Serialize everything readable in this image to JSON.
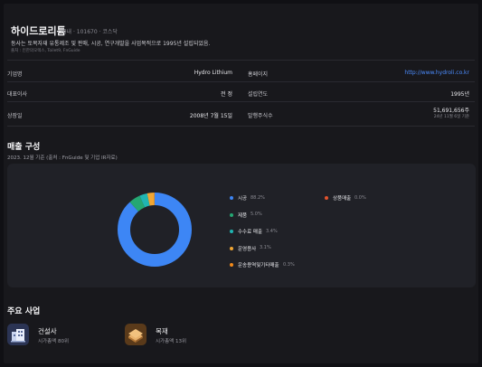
{
  "company": {
    "name": "하이드로리튬",
    "meta": "국내 · 101670 · 코스닥",
    "description": "동사는 토목자재 유통제조 및 판매, 시공, 연구개발을 사업목적으로 1995년 설립되었음.",
    "source": "출처 : 인한의오렉스, Toilet9, FnGuide"
  },
  "info": {
    "english_name_label": "기업명",
    "english_name": "Hydro Lithium",
    "homepage_label": "홈페이지",
    "homepage": "http://www.hydroli.co.kr",
    "ceo_label": "대표이사",
    "ceo": "전 정",
    "founded_label": "설립연도",
    "founded": "1995년",
    "listed_label": "상장일",
    "listed": "2008년 7월 15일",
    "shares_label": "발행주식수",
    "shares": "51,691,656주",
    "shares_date": "24년 11월 6일 기준"
  },
  "revenue": {
    "title": "매출 구성",
    "subtitle": "2023. 12월 기준 (출처 : FnGuide 및 기업 IR자료)"
  },
  "chart_data": {
    "type": "pie",
    "categories": [
      "시공",
      "제품",
      "수수료 매출",
      "운영용사",
      "운송용역및기타매출",
      "상품매출"
    ],
    "values": [
      88.2,
      5.0,
      3.4,
      3.1,
      0.3,
      0.0
    ],
    "labels": [
      "88.2%",
      "5.0%",
      "3.4%",
      "3.1%",
      "0.3%",
      "0.0%"
    ],
    "colors": [
      "#3d86f5",
      "#25a773",
      "#20b5b2",
      "#f1a633",
      "#f28a1a",
      "#e2532d"
    ],
    "style": "donut"
  },
  "business": {
    "title": "주요 사업",
    "items": [
      {
        "name": "건설사",
        "rank": "시가총액 80위",
        "icon": "building-icon"
      },
      {
        "name": "목재",
        "rank": "시가총액 13위",
        "icon": "wood-icon"
      }
    ]
  }
}
